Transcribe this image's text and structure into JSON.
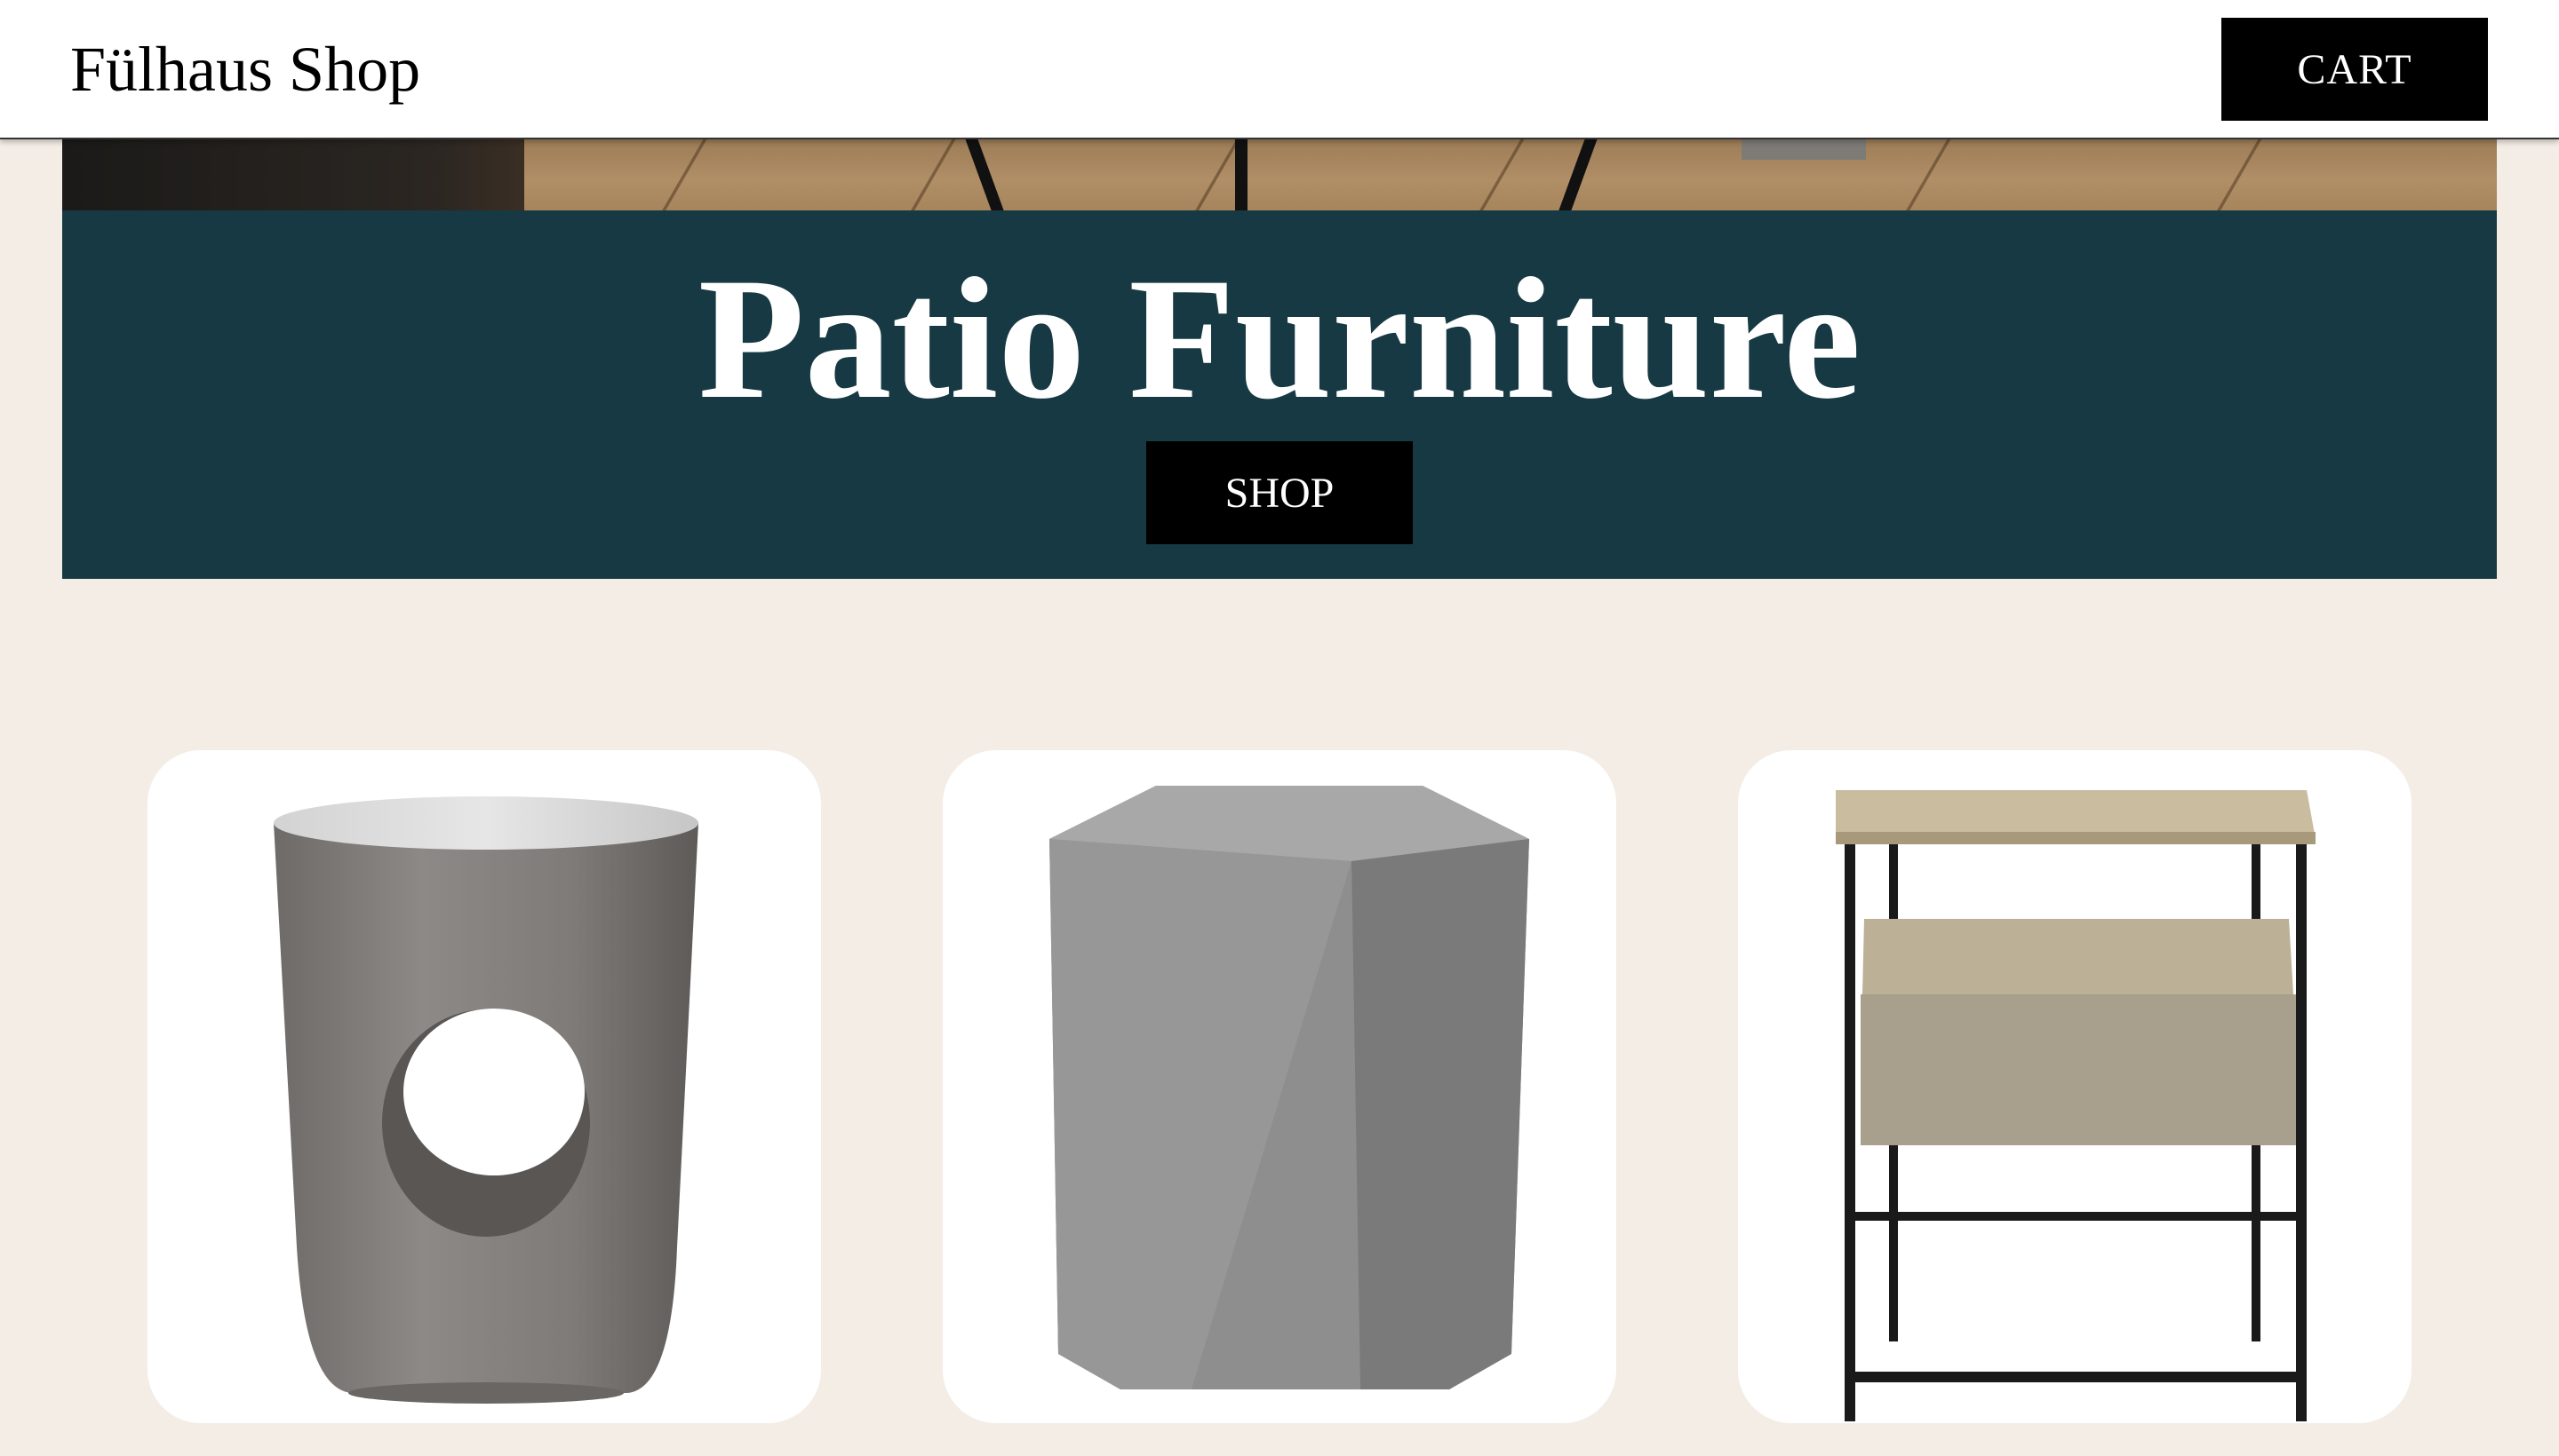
{
  "header": {
    "shop_name": "Fülhaus Shop",
    "cart_label": "CART"
  },
  "hero": {
    "title": "Patio Furniture",
    "shop_label": "SHOP",
    "banner_color": "#173943"
  },
  "products": [
    {
      "icon": "round-concrete-stool-with-cutout-icon"
    },
    {
      "icon": "faceted-concrete-stool-icon"
    },
    {
      "icon": "wood-metal-side-table-with-drawer-icon"
    }
  ],
  "colors": {
    "page_background": "#f4ede6",
    "button_background": "#000000",
    "button_text": "#ffffff"
  }
}
